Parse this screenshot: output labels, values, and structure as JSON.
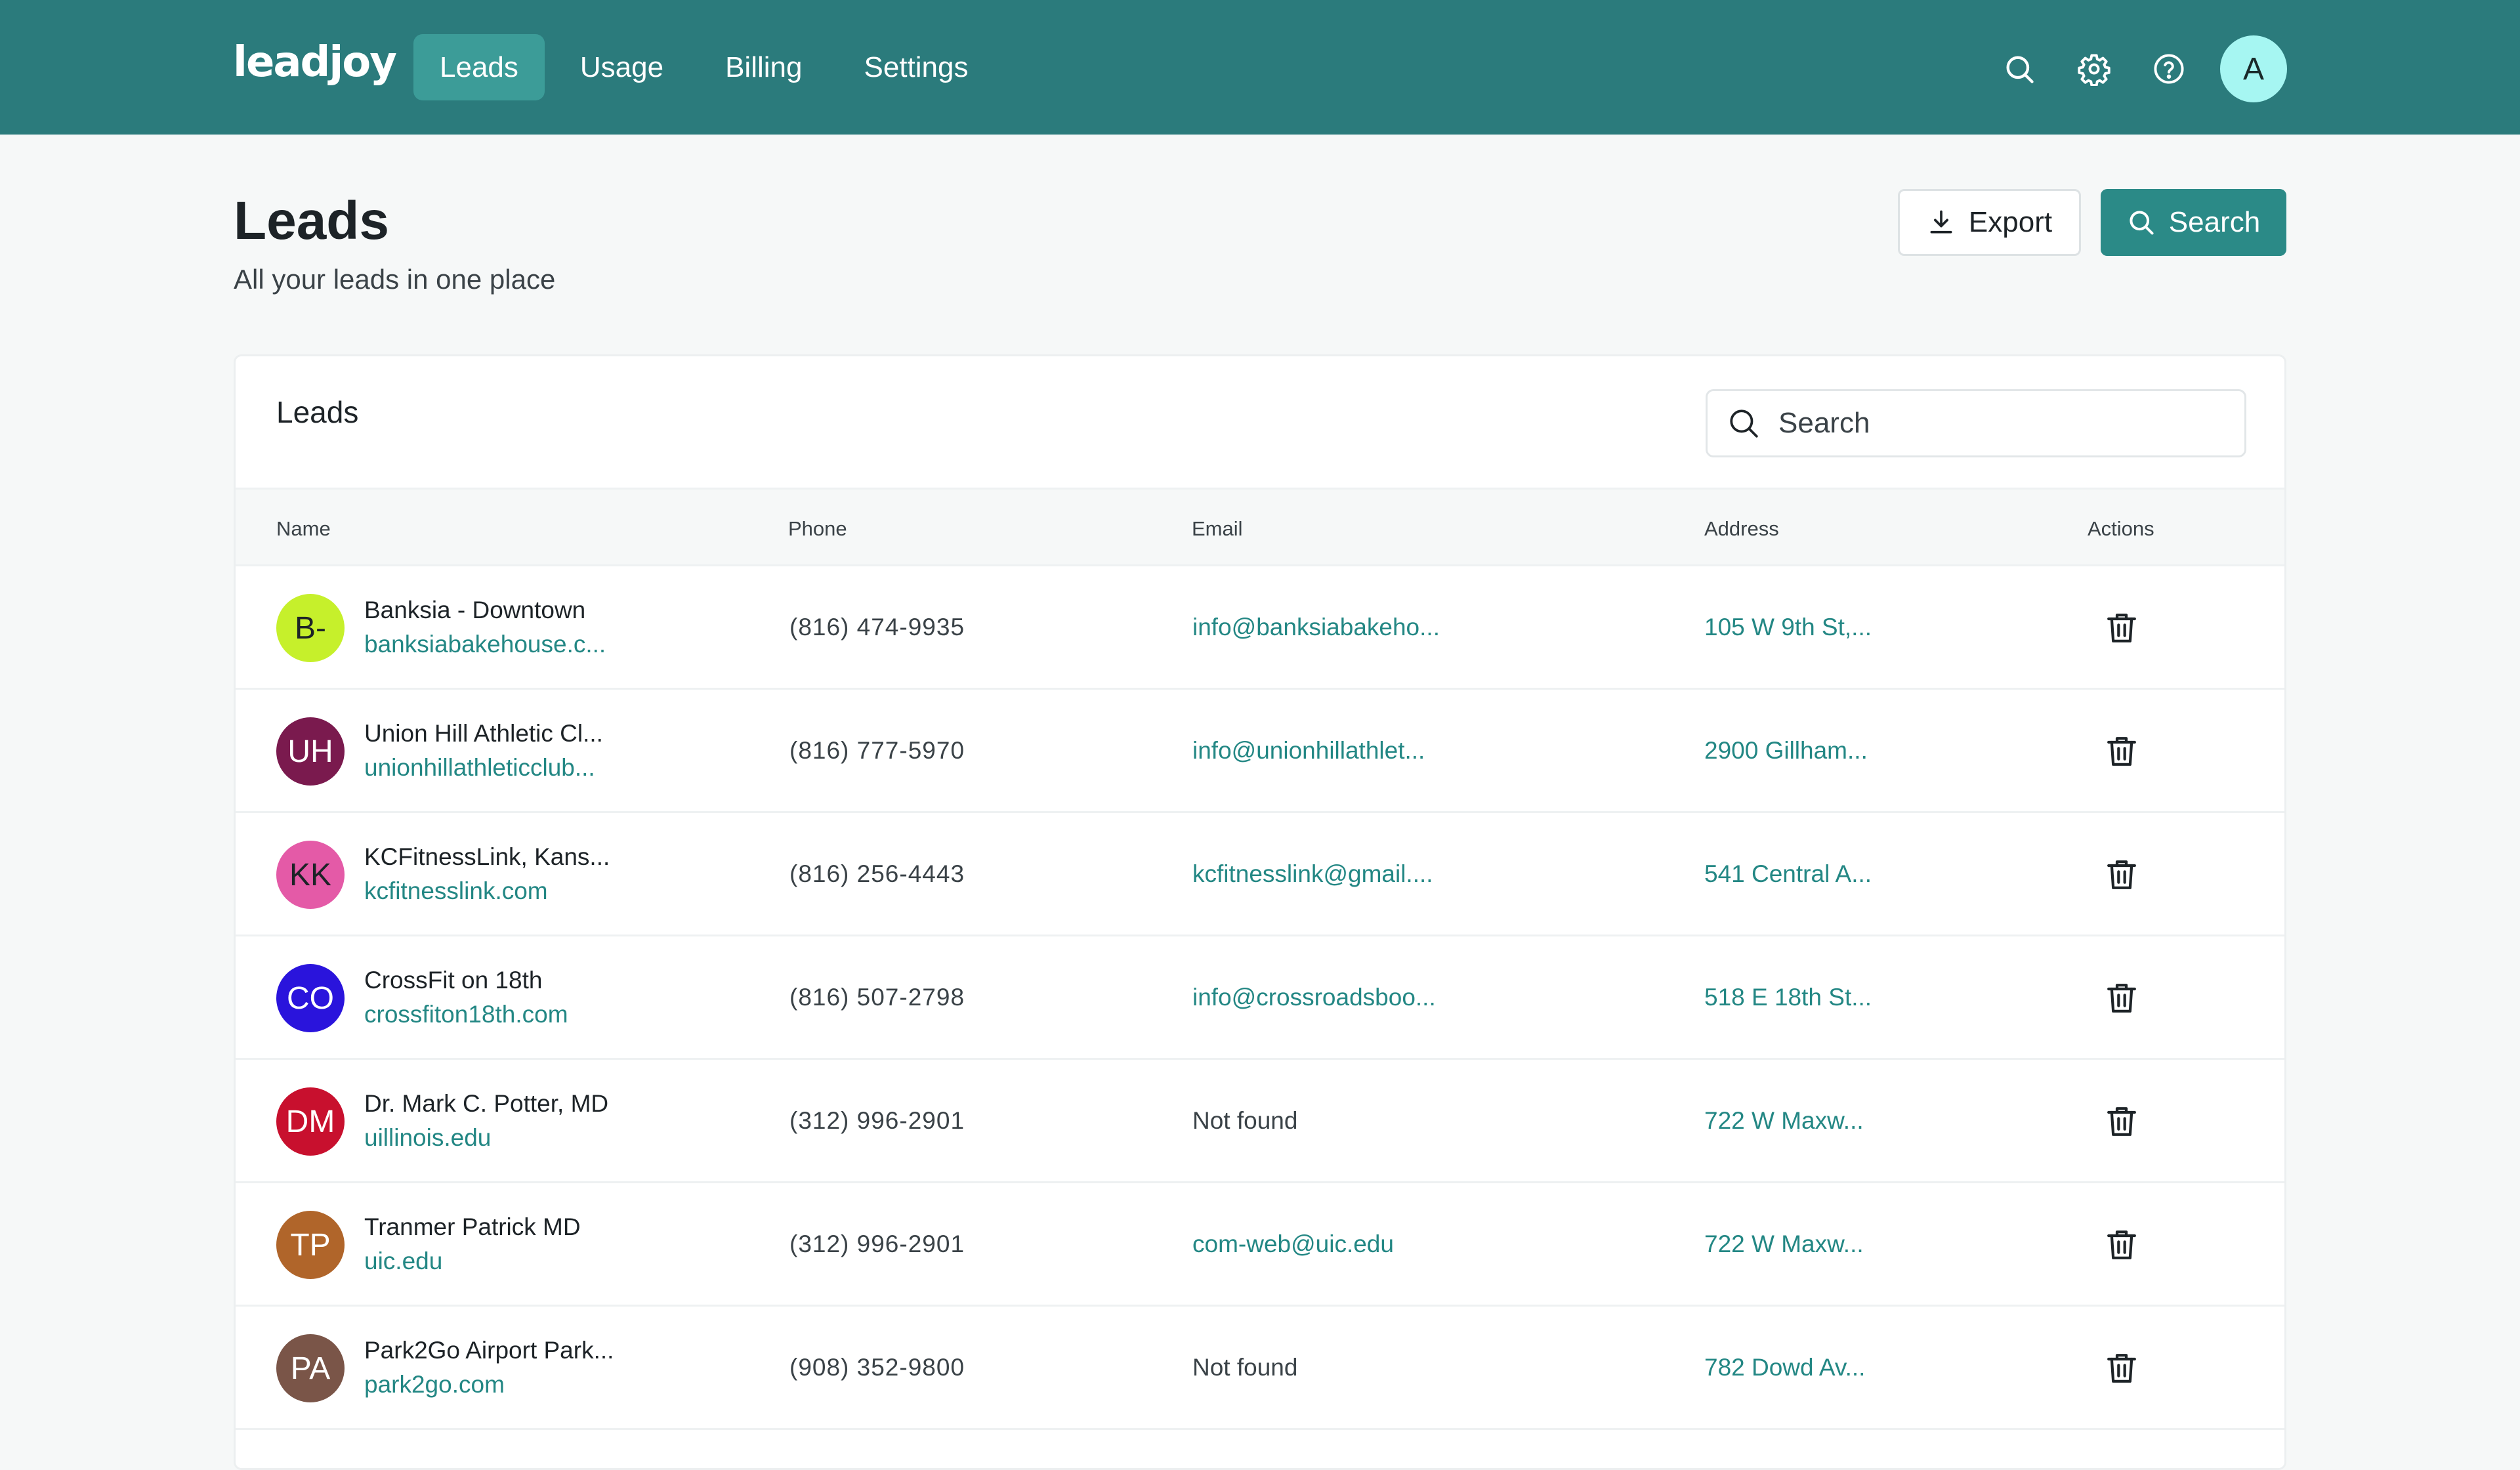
{
  "app": {
    "logo": "leadjoy",
    "nav": [
      {
        "label": "Leads",
        "active": true
      },
      {
        "label": "Usage",
        "active": false
      },
      {
        "label": "Billing",
        "active": false
      },
      {
        "label": "Settings",
        "active": false
      }
    ],
    "icons": [
      "search-icon",
      "gear-icon",
      "help-icon"
    ],
    "user_initial": "A"
  },
  "page": {
    "title": "Leads",
    "subtitle": "All your leads in one place",
    "export_label": "Export",
    "search_label": "Search"
  },
  "card": {
    "title": "Leads",
    "search_placeholder": "Search"
  },
  "table": {
    "columns": [
      "Name",
      "Phone",
      "Email",
      "Address",
      "Actions"
    ],
    "rows": [
      {
        "initials": "B-",
        "avatar_color": "#c6f02b",
        "name": "Banksia - Downtown",
        "website": "banksiabakehouse.c...",
        "phone": "(816) 474-9935",
        "email": "info@banksiabakeho...",
        "address": "105 W 9th St,..."
      },
      {
        "initials": "UH",
        "avatar_color": "#7a1a4e",
        "name": "Union Hill Athletic Cl...",
        "website": "unionhillathleticclub...",
        "phone": "(816) 777-5970",
        "email": "info@unionhillathlet...",
        "address": "2900 Gillham..."
      },
      {
        "initials": "KK",
        "avatar_color": "#e45aa7",
        "name": "KCFitnessLink, Kans...",
        "website": "kcfitnesslink.com",
        "phone": "(816) 256-4443",
        "email": "kcfitnesslink@gmail....",
        "address": "541 Central A..."
      },
      {
        "initials": "CO",
        "avatar_color": "#2a14dc",
        "name": "CrossFit on 18th",
        "website": "crossfiton18th.com",
        "phone": "(816) 507-2798",
        "email": "info@crossroadsboo...",
        "address": "518 E 18th St..."
      },
      {
        "initials": "DM",
        "avatar_color": "#c8102e",
        "name": "Dr. Mark C. Potter, MD",
        "website": "uillinois.edu",
        "phone": "(312) 996-2901",
        "email": "Not found",
        "address": "722 W Maxw..."
      },
      {
        "initials": "TP",
        "avatar_color": "#b0652a",
        "name": "Tranmer Patrick MD",
        "website": "uic.edu",
        "phone": "(312) 996-2901",
        "email": "com-web@uic.edu",
        "address": "722 W Maxw..."
      },
      {
        "initials": "PA",
        "avatar_color": "#7a5548",
        "name": "Park2Go Airport Park...",
        "website": "park2go.com",
        "phone": "(908) 352-9800",
        "email": "Not found",
        "address": "782 Dowd Av..."
      }
    ]
  }
}
